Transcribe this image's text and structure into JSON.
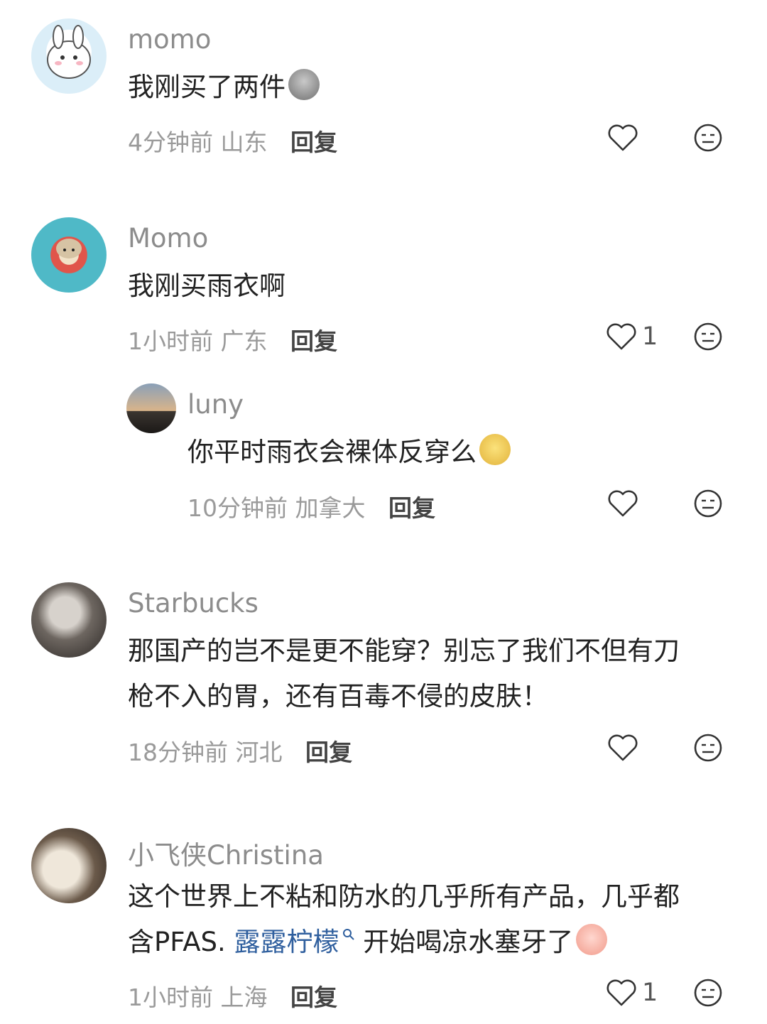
{
  "comments": [
    {
      "user": "momo",
      "text": "我刚买了两件",
      "time": "4分钟前",
      "location": "山东",
      "reply_label": "回复",
      "likes": "",
      "emoji": "gray-blob-emoji"
    },
    {
      "user": "Momo",
      "text": "我刚买雨衣啊",
      "time": "1小时前",
      "location": "广东",
      "reply_label": "回复",
      "likes": "1"
    },
    {
      "user": "luny",
      "text": "你平时雨衣会裸体反穿么",
      "time": "10分钟前",
      "location": "加拿大",
      "reply_label": "回复",
      "likes": "",
      "emoji": "yellow-pear-emoji"
    },
    {
      "user": "Starbucks",
      "text_line1": "那国产的岂不是更不能穿？别忘了我们不但有刀",
      "text_line2": "枪不入的胃，还有百毒不侵的皮肤！",
      "time": "18分钟前",
      "location": "河北",
      "reply_label": "回复",
      "likes": ""
    },
    {
      "user": "小飞侠Christina",
      "text_line1": "这个世界上不粘和防水的几乎所有产品，几乎都",
      "text_line2_pre": "含PFAS. ",
      "mention": "露露柠檬",
      "text_line2_post": " 开始喝凉水塞牙了",
      "time": "1小时前",
      "location": "上海",
      "reply_label": "回复",
      "likes": "1",
      "emoji": "crying-laugh-emoji"
    }
  ],
  "icons": {
    "like": "heart-outline-icon",
    "dislike": "meh-face-icon",
    "search": "search-mini-icon"
  }
}
